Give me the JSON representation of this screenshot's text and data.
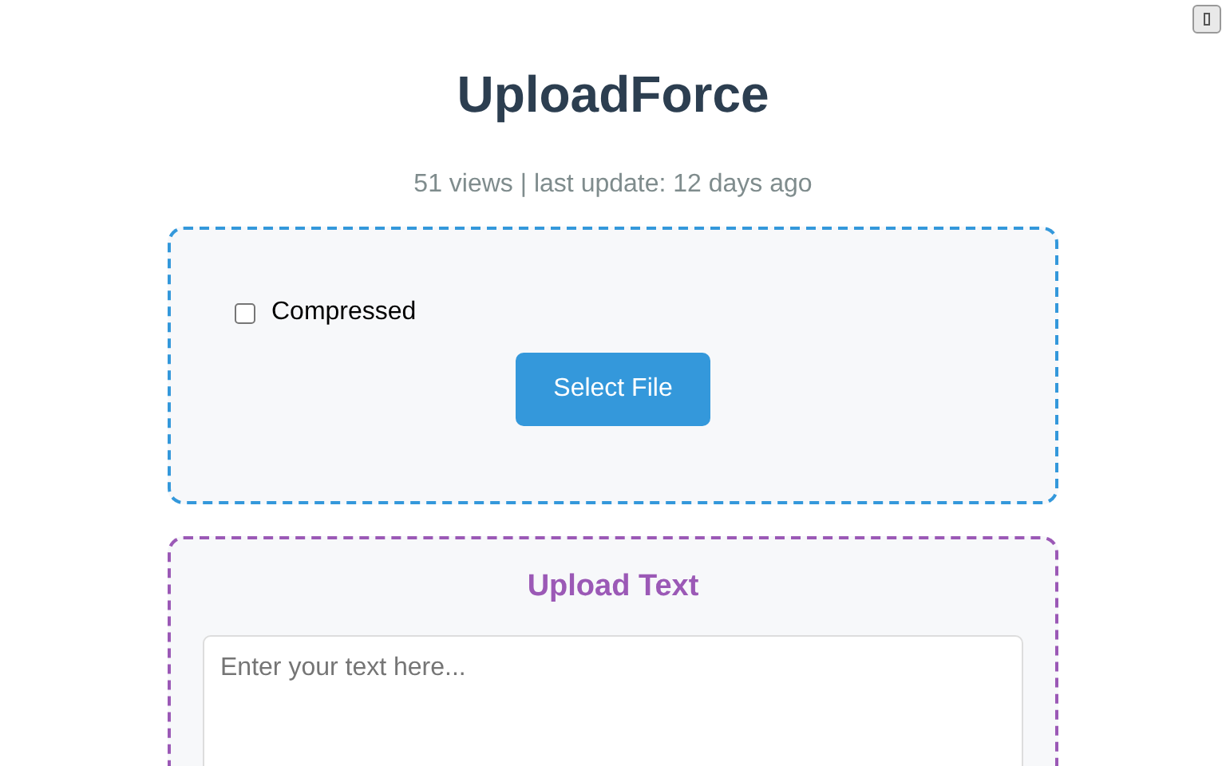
{
  "title": "UploadForce",
  "stats": "51 views | last update: 12 days ago",
  "file_upload": {
    "compressed": {
      "label": "Compressed",
      "checked": false
    },
    "button": "Select File"
  },
  "text_upload": {
    "heading": "Upload Text",
    "placeholder": "Enter your text here..."
  }
}
